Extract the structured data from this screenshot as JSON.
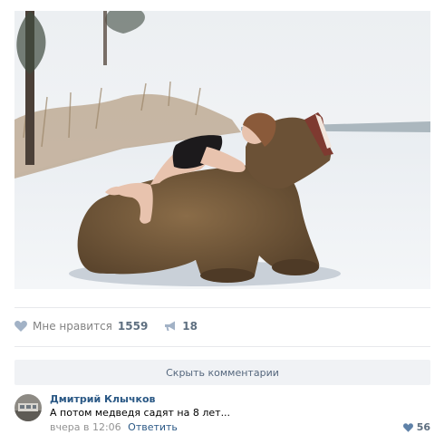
{
  "post": {
    "image_alt": "",
    "likes_label": "Мне нравится",
    "likes_count": "1559",
    "shares_count": "18",
    "hide_comments_label": "Скрыть комментарии"
  },
  "comment": {
    "author": "Дмитрий Клычков",
    "text": "А потом медведя садят на 8 лет...",
    "time": "вчера в 12:06",
    "reply_label": "Ответить",
    "likes": "56"
  },
  "colors": {
    "link": "#2a5885",
    "muted": "#828282",
    "button_bg": "#f0f2f5",
    "like_icon": "#a2b2c6"
  }
}
